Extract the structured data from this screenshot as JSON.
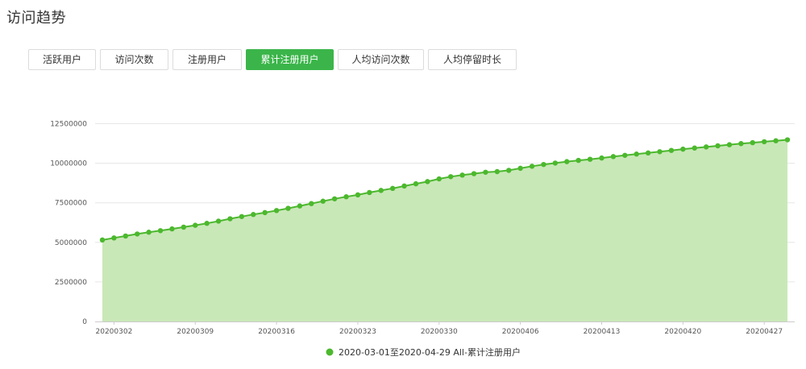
{
  "header": {
    "title": "访问趋势"
  },
  "tabs": [
    {
      "label": "活跃用户",
      "active": false
    },
    {
      "label": "访问次数",
      "active": false
    },
    {
      "label": "注册用户",
      "active": false
    },
    {
      "label": "累计注册用户",
      "active": true
    },
    {
      "label": "人均访问次数",
      "active": false
    },
    {
      "label": "人均停留时长",
      "active": false
    }
  ],
  "colors": {
    "accent": "#3bb54a",
    "line": "#4cb82e",
    "area": "#c9e8b8",
    "grid": "#e6e6e6"
  },
  "chart_data": {
    "type": "area",
    "legend": {
      "label": "2020-03-01至2020-04-29 All-累计注册用户",
      "position": "bottom-center"
    },
    "grid": true,
    "ylim": [
      0,
      12500000
    ],
    "y_ticks": [
      "0",
      "2500000",
      "5000000",
      "7500000",
      "10000000",
      "12500000"
    ],
    "x_tick_labels": [
      "20200302",
      "20200309",
      "20200316",
      "20200323",
      "20200330",
      "20200406",
      "20200413",
      "20200420",
      "20200427"
    ],
    "x": [
      "20200301",
      "20200302",
      "20200303",
      "20200304",
      "20200305",
      "20200306",
      "20200307",
      "20200308",
      "20200309",
      "20200310",
      "20200311",
      "20200312",
      "20200313",
      "20200314",
      "20200315",
      "20200316",
      "20200317",
      "20200318",
      "20200319",
      "20200320",
      "20200321",
      "20200322",
      "20200323",
      "20200324",
      "20200325",
      "20200326",
      "20200327",
      "20200328",
      "20200329",
      "20200330",
      "20200331",
      "20200401",
      "20200402",
      "20200403",
      "20200404",
      "20200405",
      "20200406",
      "20200407",
      "20200408",
      "20200409",
      "20200410",
      "20200411",
      "20200412",
      "20200413",
      "20200414",
      "20200415",
      "20200416",
      "20200417",
      "20200418",
      "20200419",
      "20200420",
      "20200421",
      "20200422",
      "20200423",
      "20200424",
      "20200425",
      "20200426",
      "20200427",
      "20200428",
      "20200429"
    ],
    "series": [
      {
        "name": "2020-03-01至2020-04-29 All-累计注册用户",
        "values": [
          5150000,
          5280000,
          5400000,
          5530000,
          5640000,
          5740000,
          5850000,
          5960000,
          6080000,
          6200000,
          6340000,
          6490000,
          6630000,
          6760000,
          6880000,
          7010000,
          7150000,
          7300000,
          7450000,
          7600000,
          7750000,
          7880000,
          8000000,
          8150000,
          8280000,
          8410000,
          8560000,
          8700000,
          8840000,
          9010000,
          9150000,
          9250000,
          9340000,
          9430000,
          9470000,
          9550000,
          9680000,
          9810000,
          9920000,
          10010000,
          10100000,
          10180000,
          10250000,
          10330000,
          10420000,
          10500000,
          10580000,
          10650000,
          10730000,
          10810000,
          10890000,
          10960000,
          11030000,
          11100000,
          11170000,
          11240000,
          11300000,
          11360000,
          11420000,
          11480000
        ]
      }
    ]
  }
}
